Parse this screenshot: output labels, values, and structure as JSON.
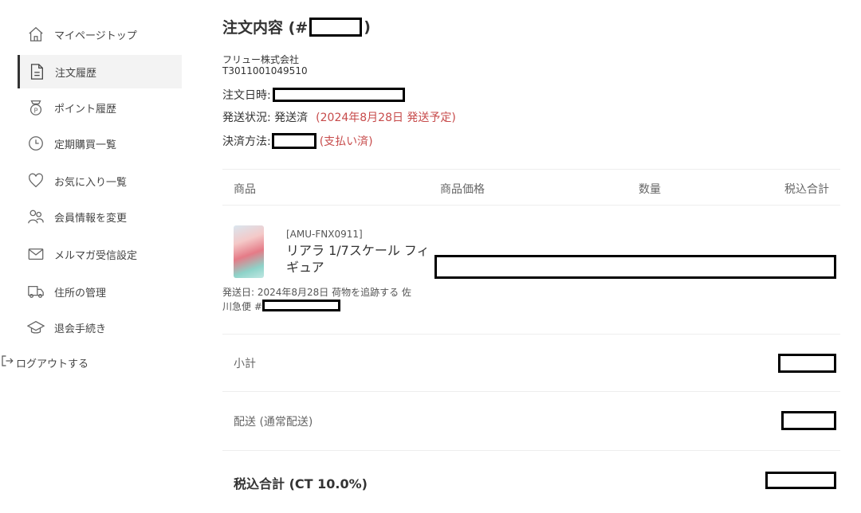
{
  "sidebar": {
    "items": [
      {
        "label": "マイページトップ",
        "icon": "home-icon"
      },
      {
        "label": "注文履歴",
        "icon": "document-icon",
        "active": true
      },
      {
        "label": "ポイント履歴",
        "icon": "points-icon"
      },
      {
        "label": "定期購買一覧",
        "icon": "clock-icon"
      },
      {
        "label": "お気に入り一覧",
        "icon": "heart-icon"
      },
      {
        "label": "会員情報を変更",
        "icon": "users-icon"
      },
      {
        "label": "メルマガ受信設定",
        "icon": "mail-icon"
      },
      {
        "label": "住所の管理",
        "icon": "truck-icon"
      },
      {
        "label": "退会手続き",
        "icon": "cap-icon"
      }
    ],
    "logout": "ログアウトする"
  },
  "order": {
    "title_prefix": "注文内容 (#",
    "title_suffix": ")",
    "seller": "フリュー株式会社",
    "reg_number": "T3011001049510",
    "date_label": "注文日時:",
    "status_label": "発送状況: 発送済",
    "status_note": "(2024年8月28日 発送予定)",
    "payment_label": "決済方法:",
    "payment_status": "(支払い済)"
  },
  "table": {
    "headers": {
      "product": "商品",
      "price": "商品価格",
      "qty": "数量",
      "total": "税込合計"
    }
  },
  "item": {
    "sku": "[AMU-FNX0911]",
    "name": "リアラ 1/7スケール フィギュア",
    "ship_text": "発送日: 2024年8月28日 荷物を追跡する 佐川急便 #"
  },
  "summary": {
    "subtotal_label": "小計",
    "shipping_label": "配送 (通常配送)",
    "total_label": "税込合計 (CT 10.0%)"
  },
  "colors": {
    "accent_red": "#c74b4b",
    "active_bg": "#f3f3f3"
  }
}
